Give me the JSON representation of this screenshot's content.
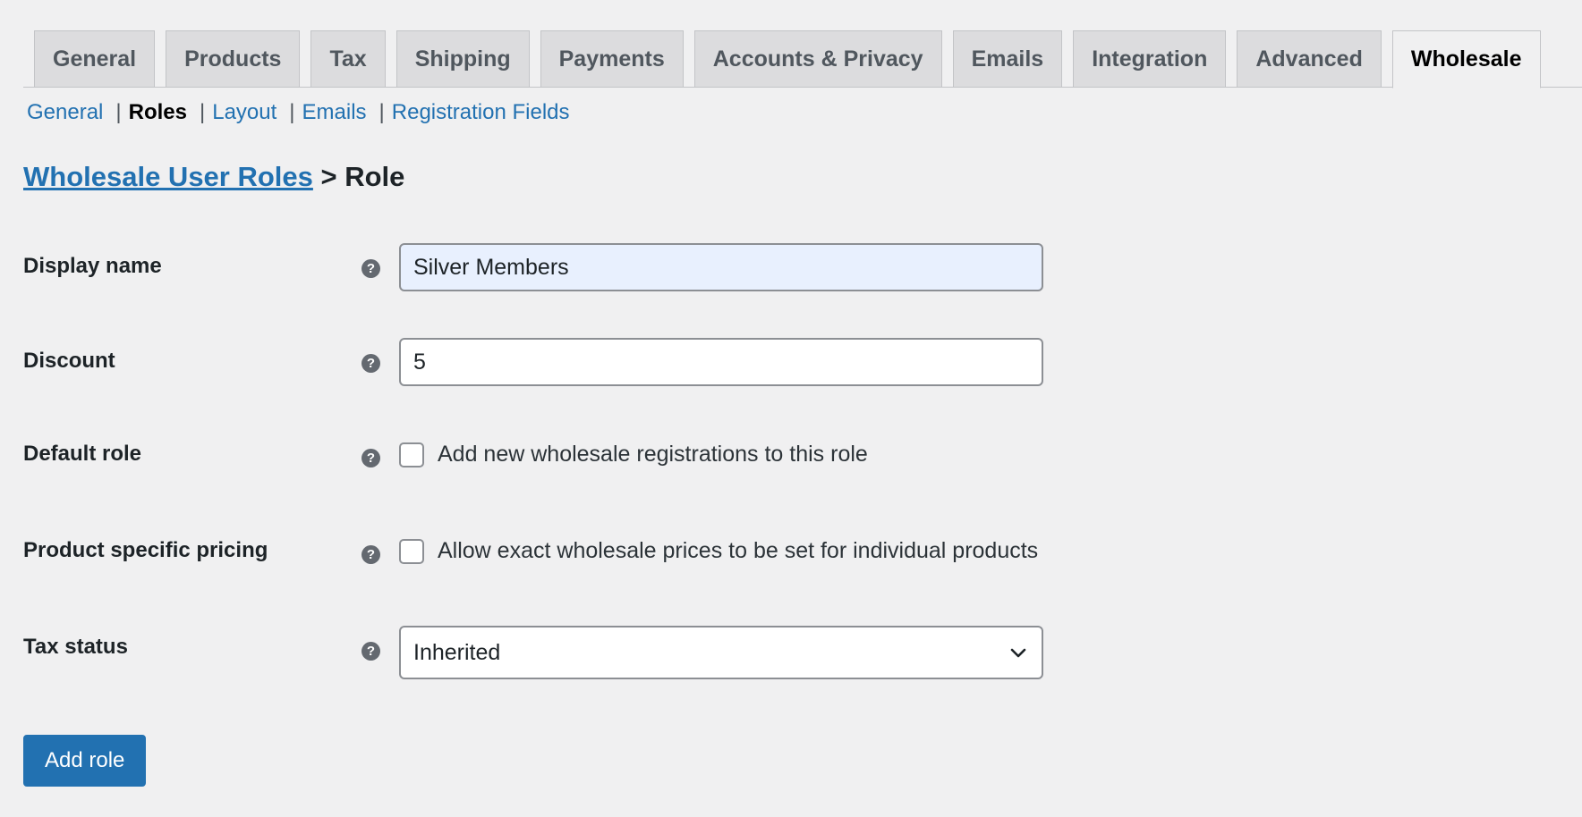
{
  "tabs": [
    {
      "label": "General"
    },
    {
      "label": "Products"
    },
    {
      "label": "Tax"
    },
    {
      "label": "Shipping"
    },
    {
      "label": "Payments"
    },
    {
      "label": "Accounts & Privacy"
    },
    {
      "label": "Emails"
    },
    {
      "label": "Integration"
    },
    {
      "label": "Advanced"
    },
    {
      "label": "Wholesale"
    }
  ],
  "subnav": {
    "general": "General",
    "roles": "Roles",
    "layout": "Layout",
    "emails": "Emails",
    "registration_fields": "Registration Fields",
    "separator": "|"
  },
  "heading": {
    "link": "Wholesale User Roles",
    "suffix": " > Role"
  },
  "form": {
    "help_glyph": "?",
    "display_name": {
      "label": "Display name",
      "value": "Silver Members"
    },
    "discount": {
      "label": "Discount",
      "value": "5"
    },
    "default_role": {
      "label": "Default role",
      "checkbox_label": "Add new wholesale registrations to this role"
    },
    "product_pricing": {
      "label": "Product specific pricing",
      "checkbox_label": "Allow exact wholesale prices to be set for individual products"
    },
    "tax_status": {
      "label": "Tax status",
      "value": "Inherited"
    }
  },
  "actions": {
    "add_role": "Add role"
  }
}
